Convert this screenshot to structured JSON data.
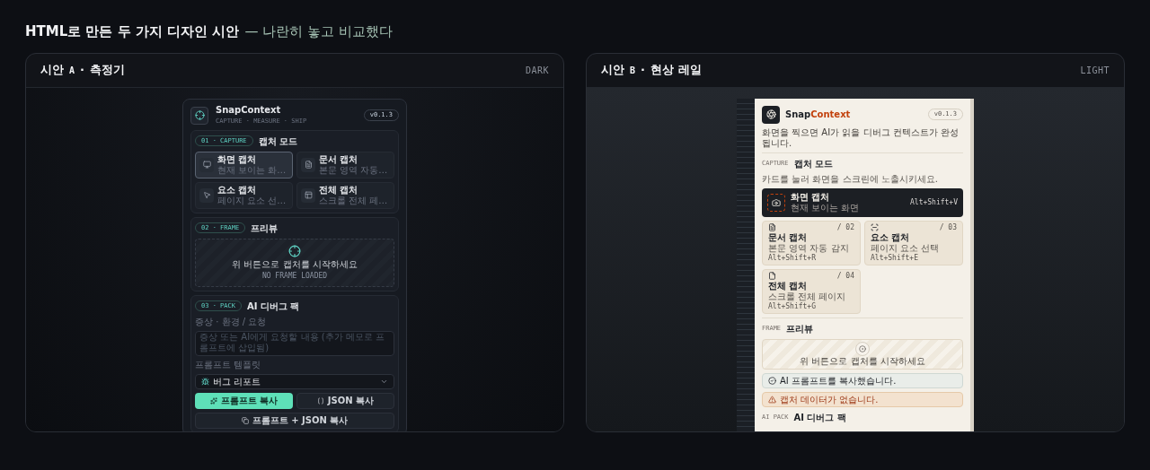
{
  "heading": {
    "strong": "HTML로 만든 두 가지 디자인 시안",
    "rest": "— 나란히 놓고 비교했다"
  },
  "panels": [
    {
      "kind": "dark",
      "title": "시안",
      "letter": "A",
      "separator": "·",
      "subtitle": "측정기",
      "theme_label": "DARK",
      "app": {
        "name": "SnapContext",
        "tagline": "CAPTURE · MEASURE · SHIP",
        "version": "v0.1.3",
        "capture": {
          "tag": "01 · CAPTURE",
          "title": "캡처 모드",
          "modes": [
            {
              "title": "화면 캡처",
              "desc": "현재 보이는 화…",
              "selected": true
            },
            {
              "title": "문서 캡처",
              "desc": "본문 영역 자동…",
              "selected": false
            },
            {
              "title": "요소 캡처",
              "desc": "페이지 요소 선…",
              "selected": false
            },
            {
              "title": "전체 캡처",
              "desc": "스크롤 전체 페…",
              "selected": false
            }
          ]
        },
        "preview": {
          "tag": "02 · FRAME",
          "title": "프리뷰",
          "message": "위 버튼으로 캡처를 시작하세요",
          "status": "NO FRAME LOADED"
        },
        "pack": {
          "tag": "03 · PACK",
          "title": "AI 디버그 팩",
          "notes_label": "증상 · 환경 / 요청",
          "notes_placeholder": "증상 또는 AI에게 요청할 내용 (추가 메모로 프롬프트에 삽입됨)",
          "template_label": "프롬프트 템플릿",
          "template": "버그 리포트",
          "buttons": [
            {
              "label": "프롬프트 복사",
              "primary": true
            },
            {
              "label": "JSON 복사",
              "primary": false
            },
            {
              "label": "프롬프트 + JSON 복사",
              "primary": false
            }
          ]
        }
      }
    },
    {
      "kind": "light",
      "title": "시안",
      "letter": "B",
      "separator": "·",
      "subtitle": "현상 레일",
      "theme_label": "LIGHT",
      "app": {
        "name_a": "Snap",
        "name_b": "Context",
        "version": "v0.1.3",
        "intro": "화면을 찍으면 AI가 읽을 디버그 컨텍스트가 완성됩니다.",
        "capture": {
          "tag": "CAPTURE",
          "title": "캡처 모드",
          "hint": "카드를 눌러 화면을 스크린에 노출시키세요.",
          "modes": [
            {
              "title": "화면 캡처",
              "desc": "현재 보이는 화면",
              "shortcut": "Alt+Shift+V",
              "selected": true
            },
            {
              "index": "/ 02",
              "title": "문서 캡처",
              "desc": "본문 영역 자동 감지",
              "shortcut": "Alt+Shift+R",
              "selected": false
            },
            {
              "index": "/ 03",
              "title": "요소 캡처",
              "desc": "페이지 요소 선택",
              "shortcut": "Alt+Shift+E",
              "selected": false
            },
            {
              "index": "/ 04",
              "title": "전체 캡처",
              "desc": "스크롤 전체 페이지",
              "shortcut": "Alt+Shift+G",
              "selected": false
            }
          ]
        },
        "preview": {
          "tag": "FRAME",
          "title": "프리뷰",
          "message": "위 버튼으로 캡처를 시작하세요"
        },
        "toasts": [
          {
            "kind": "success",
            "text": "AI 프롬프트를 복사했습니다."
          },
          {
            "kind": "warning",
            "text": "캡처 데이터가 없습니다."
          }
        ],
        "pack": {
          "tag": "AI PACK",
          "title": "AI 디버그 팩"
        }
      }
    }
  ]
}
